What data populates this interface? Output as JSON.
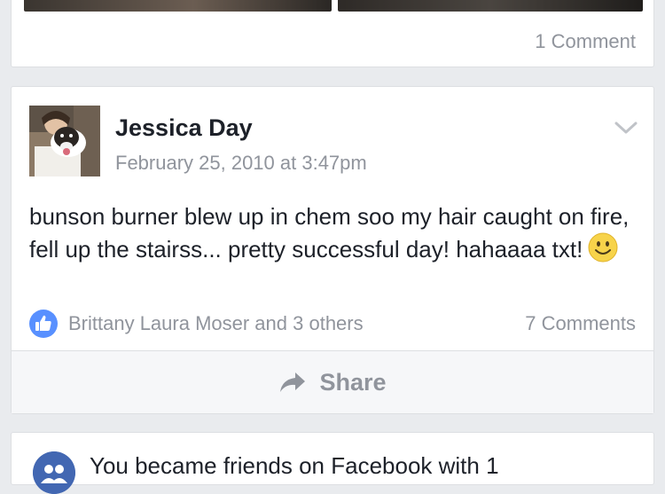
{
  "previous_post": {
    "comments_count": "1 Comment"
  },
  "post": {
    "author": "Jessica Day",
    "timestamp": "February 25, 2010 at 3:47pm",
    "text": "bunson burner blew up in chem soo my hair caught on fire, fell up the stairss... pretty successful day! hahaaaa txt!",
    "emoji": "smiley-face-icon",
    "reactions": {
      "icon": "like-icon",
      "text": "Brittany Laura Moser and 3 others"
    },
    "comments_count": "7 Comments",
    "share_label": "Share"
  },
  "next_story": {
    "icon": "friends-icon",
    "text": "You became friends on Facebook with 1"
  },
  "colors": {
    "background": "#e9ebee",
    "card": "#ffffff",
    "primary_text": "#1d2129",
    "secondary_text": "#90949c",
    "accent_blue": "#4267b2",
    "like_blue": "#5890ff"
  }
}
